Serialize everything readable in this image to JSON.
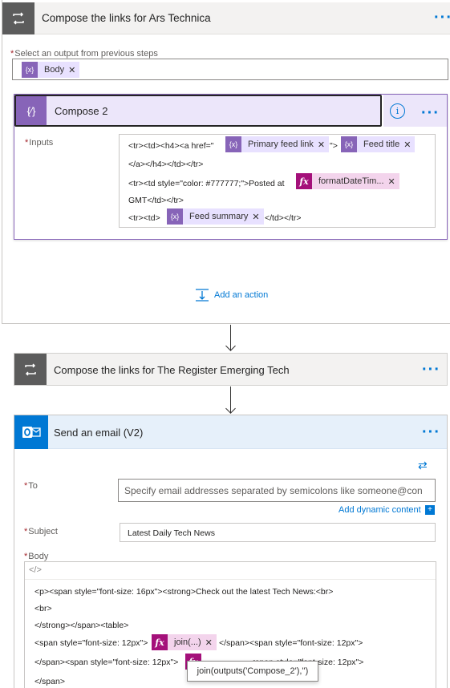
{
  "ars_loop": {
    "title": "Compose the links for Ars Technica",
    "select_label": "Select an output from previous steps",
    "select_token": "Body"
  },
  "compose2": {
    "title": "Compose 2",
    "info_glyph": "i",
    "inputs_label": "Inputs",
    "line1_a": "<tr><td><h4><a href=\"",
    "token_primary": "Primary feed link",
    "line1_b": "\">",
    "token_feed_title": "Feed title",
    "line2": "</a></h4></td></tr>",
    "line3_a": "<tr><td style=\"color: #777777;\">Posted at",
    "token_format_date": "formatDateTim...",
    "line4": "GMT</td></tr>",
    "line5_a": "<tr><td>",
    "token_feed_summary": "Feed summary",
    "line5_b": "</td></tr>"
  },
  "add_action": {
    "label": "Add an action"
  },
  "register_loop": {
    "title": "Compose the links for The Register Emerging Tech"
  },
  "email": {
    "title": "Send an email (V2)",
    "to_label": "To",
    "to_placeholder": "Specify email addresses separated by semicolons like someone@con",
    "add_dynamic": "Add dynamic content",
    "subject_label": "Subject",
    "subject_value": "Latest Daily Tech News",
    "body_label": "Body",
    "code_toggle": "</>",
    "body_line1": "<p><span style=\"font-size: 16px\"><strong>Check out the latest Tech News:<br>",
    "body_line2": "<br>",
    "body_line3": "</strong></span><table>",
    "body_line4_a": "<span style=\"font-size: 12px\">",
    "token_join": "join(...)",
    "body_line4_b": "</span><span style=\"font-size: 12px\">",
    "body_line5_a": "</span><span style=\"font-size: 12px\">",
    "body_line5_b": "<span style=\"font-size: 12px\">",
    "body_line6": "</span>",
    "tooltip": "join(outputs('Compose_2'),'')"
  },
  "colors": {
    "compose_accent": "#8764b8",
    "expression_accent": "#a4107a",
    "link": "#0078d4",
    "required": "#a4262c"
  }
}
